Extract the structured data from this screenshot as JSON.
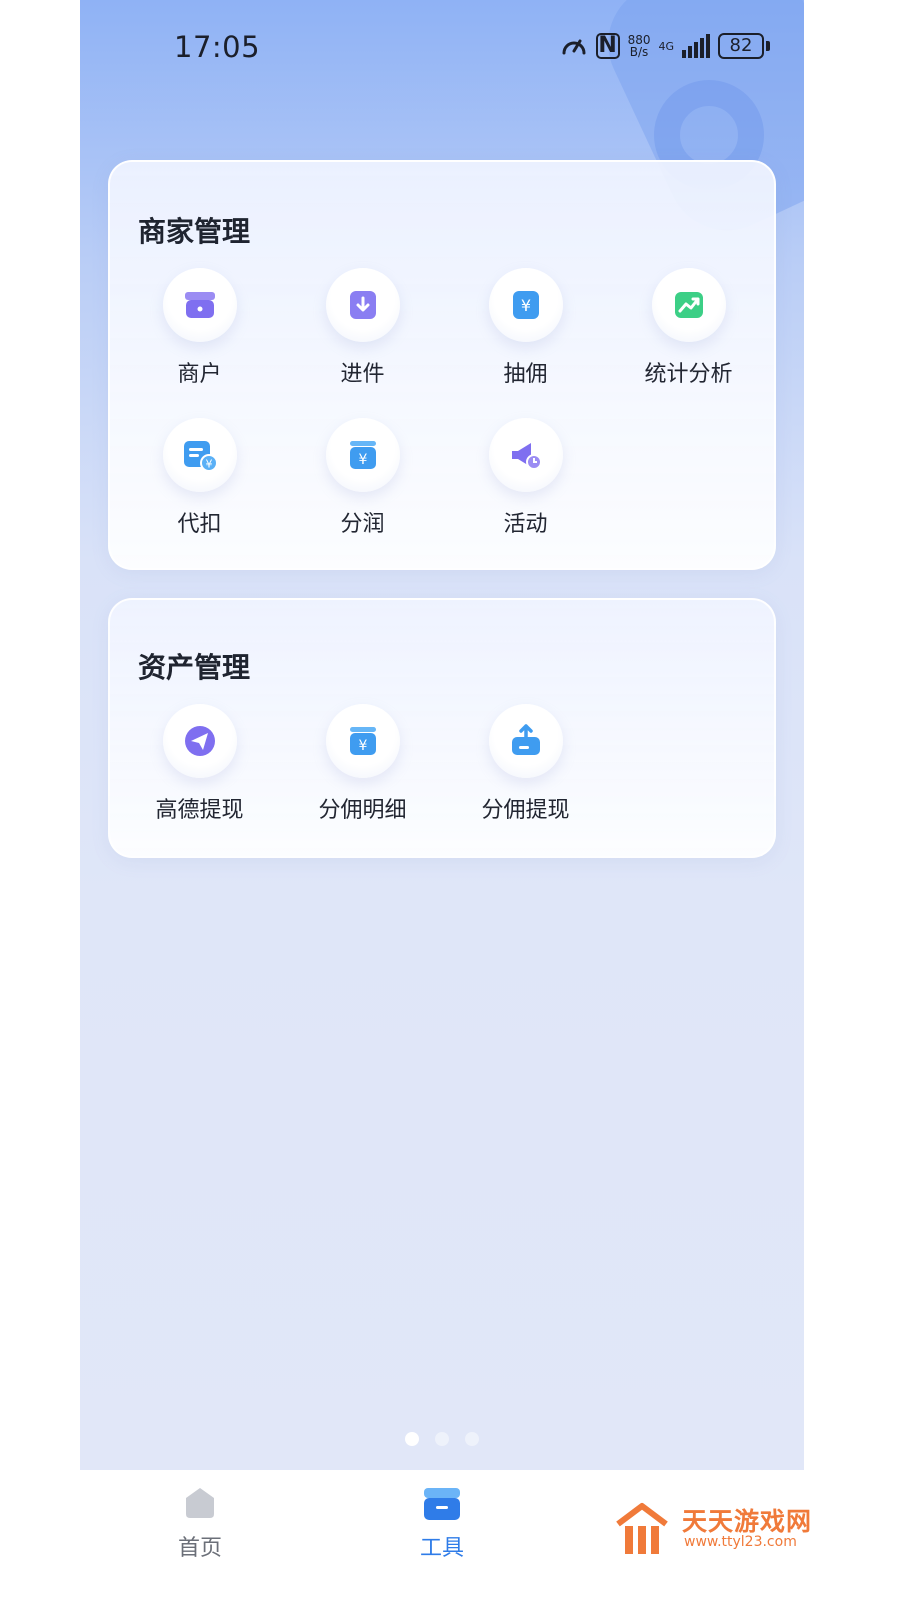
{
  "statusbar": {
    "time": "17:05",
    "netspeed_value": "880",
    "netspeed_unit": "B/s",
    "network": "4G",
    "battery": "82"
  },
  "merchant_section": {
    "title": "商家管理",
    "items": [
      {
        "label": "商户",
        "icon": "store-icon"
      },
      {
        "label": "进件",
        "icon": "download-box-icon"
      },
      {
        "label": "抽佣",
        "icon": "yuan-wallet-icon"
      },
      {
        "label": "统计分析",
        "icon": "trend-chart-icon"
      },
      {
        "label": "代扣",
        "icon": "bill-yuan-icon"
      },
      {
        "label": "分润",
        "icon": "yuan-box-icon"
      },
      {
        "label": "活动",
        "icon": "megaphone-icon"
      }
    ]
  },
  "assets_section": {
    "title": "资产管理",
    "items": [
      {
        "label": "高德提现",
        "icon": "paper-plane-icon"
      },
      {
        "label": "分佣明细",
        "icon": "yuan-box-icon"
      },
      {
        "label": "分佣提现",
        "icon": "upload-box-icon"
      }
    ]
  },
  "pager": {
    "count": 3,
    "active_index": 0
  },
  "tabbar": {
    "home_label": "首页",
    "tools_label": "工具",
    "active_color": "#2f7ce8"
  },
  "watermark": {
    "name": "天天游戏网",
    "url": "www.ttyl23.com"
  }
}
